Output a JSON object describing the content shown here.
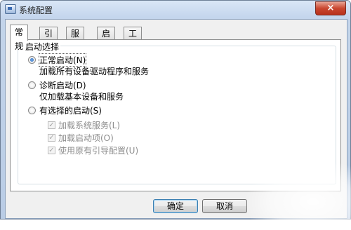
{
  "window": {
    "title": "系统配置",
    "close_glyph": "×"
  },
  "tabs": [
    "常规",
    "引导",
    "服务",
    "启动",
    "工具"
  ],
  "general": {
    "group_label": "启动选择",
    "options": [
      {
        "label": "正常启动(N)",
        "description": "加载所有设备驱动程序和服务",
        "selected": true
      },
      {
        "label": "诊断启动(D)",
        "description": "仅加载基本设备和服务",
        "selected": false
      },
      {
        "label": "有选择的启动(S)",
        "selected": false
      }
    ],
    "selective_items": [
      {
        "label": "加载系统服务(L)",
        "checked": true,
        "enabled": false
      },
      {
        "label": "加载启动项(O)",
        "checked": true,
        "enabled": false
      },
      {
        "label": "使用原有引导配置(U)",
        "checked": true,
        "enabled": false
      }
    ]
  },
  "buttons": {
    "ok": "确定",
    "cancel": "取消"
  },
  "icons": {
    "app": "system-config-icon",
    "close": "close-icon"
  },
  "colors": {
    "close": "#c9462f",
    "selected_radio": "#1d5fb5",
    "disabled_text": "#8d8d8d"
  }
}
